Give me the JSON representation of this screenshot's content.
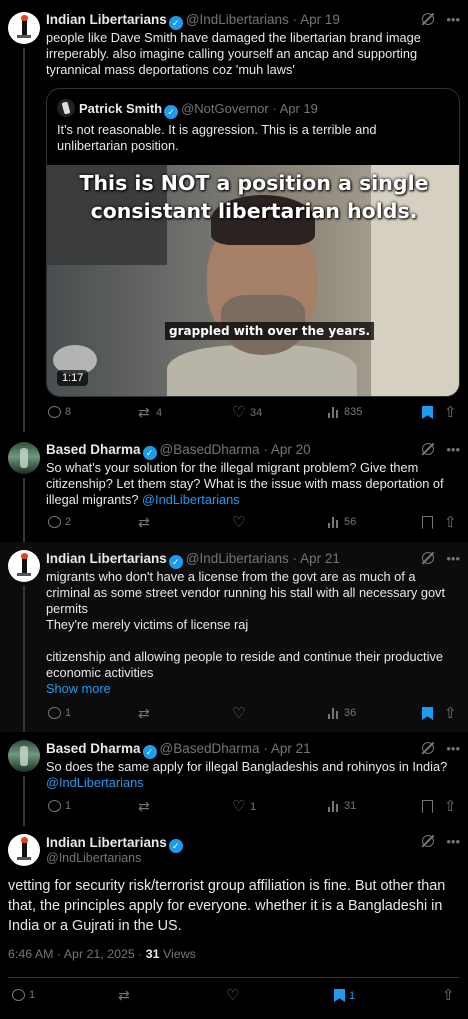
{
  "tweets": [
    {
      "name": "Indian Libertarians",
      "handle": "@IndLibertarians",
      "date": "· Apr 19",
      "text": "people like Dave Smith have damaged the libertarian brand image irreperably. also imagine calling yourself an ancap and supporting tyrannical mass deportations coz 'muh laws'",
      "quote": {
        "name": "Patrick Smith",
        "handle": "@NotGovernor",
        "date": "· Apr 19",
        "text": "It's not reasonable. It is aggression. This is a terrible and unlibertarian position.",
        "video_title": "This is NOT a position a single consistant libertarian holds.",
        "video_subtitle": "grappled with over the years.",
        "video_time": "1:17"
      },
      "replies": "8",
      "retweets": "4",
      "likes": "34",
      "views": "835"
    },
    {
      "name": "Based Dharma",
      "handle": "@BasedDharma",
      "date": "· Apr 20",
      "text": "So what's your solution for the illegal migrant problem? Give them citizenship? Let them stay?  What is the issue with mass deportation of illegal migrants?",
      "mention": "@IndLibertarians",
      "replies": "2",
      "retweets": "",
      "likes": "",
      "views": "56"
    },
    {
      "name": "Indian Libertarians",
      "handle": "@IndLibertarians",
      "date": "· Apr 21",
      "text_p1": "migrants who don't have a license from the govt are as much of a criminal as some street vendor running his stall with all necessary govt permits",
      "text_p2": "They're merely victims of license raj",
      "text_p3": "citizenship and allowing people to reside and continue their productive economic activities",
      "show_more": "Show more",
      "replies": "1",
      "retweets": "",
      "likes": "",
      "views": "36"
    },
    {
      "name": "Based Dharma",
      "handle": "@BasedDharma",
      "date": "· Apr 21",
      "text": "So does the same apply for illegal Bangladeshis and rohinyos in India?",
      "mention": "@IndLibertarians",
      "replies": "1",
      "retweets": "",
      "likes": "1",
      "views": "31"
    }
  ],
  "main": {
    "name": "Indian Libertarians",
    "handle": "@IndLibertarians",
    "text": "vetting for security risk/terrorist group affiliation is fine. But other than that, the principles apply for everyone. whether it is a Bangladeshi in India or a Gujrati in the US.",
    "time": "6:46 AM · Apr 21, 2025 · ",
    "views": "31",
    "views_label": " Views",
    "replies": "1",
    "bookmarks": "1"
  },
  "colors": {
    "accent": "#1d9bf0",
    "muted": "#71767b",
    "bg": "#000000"
  }
}
